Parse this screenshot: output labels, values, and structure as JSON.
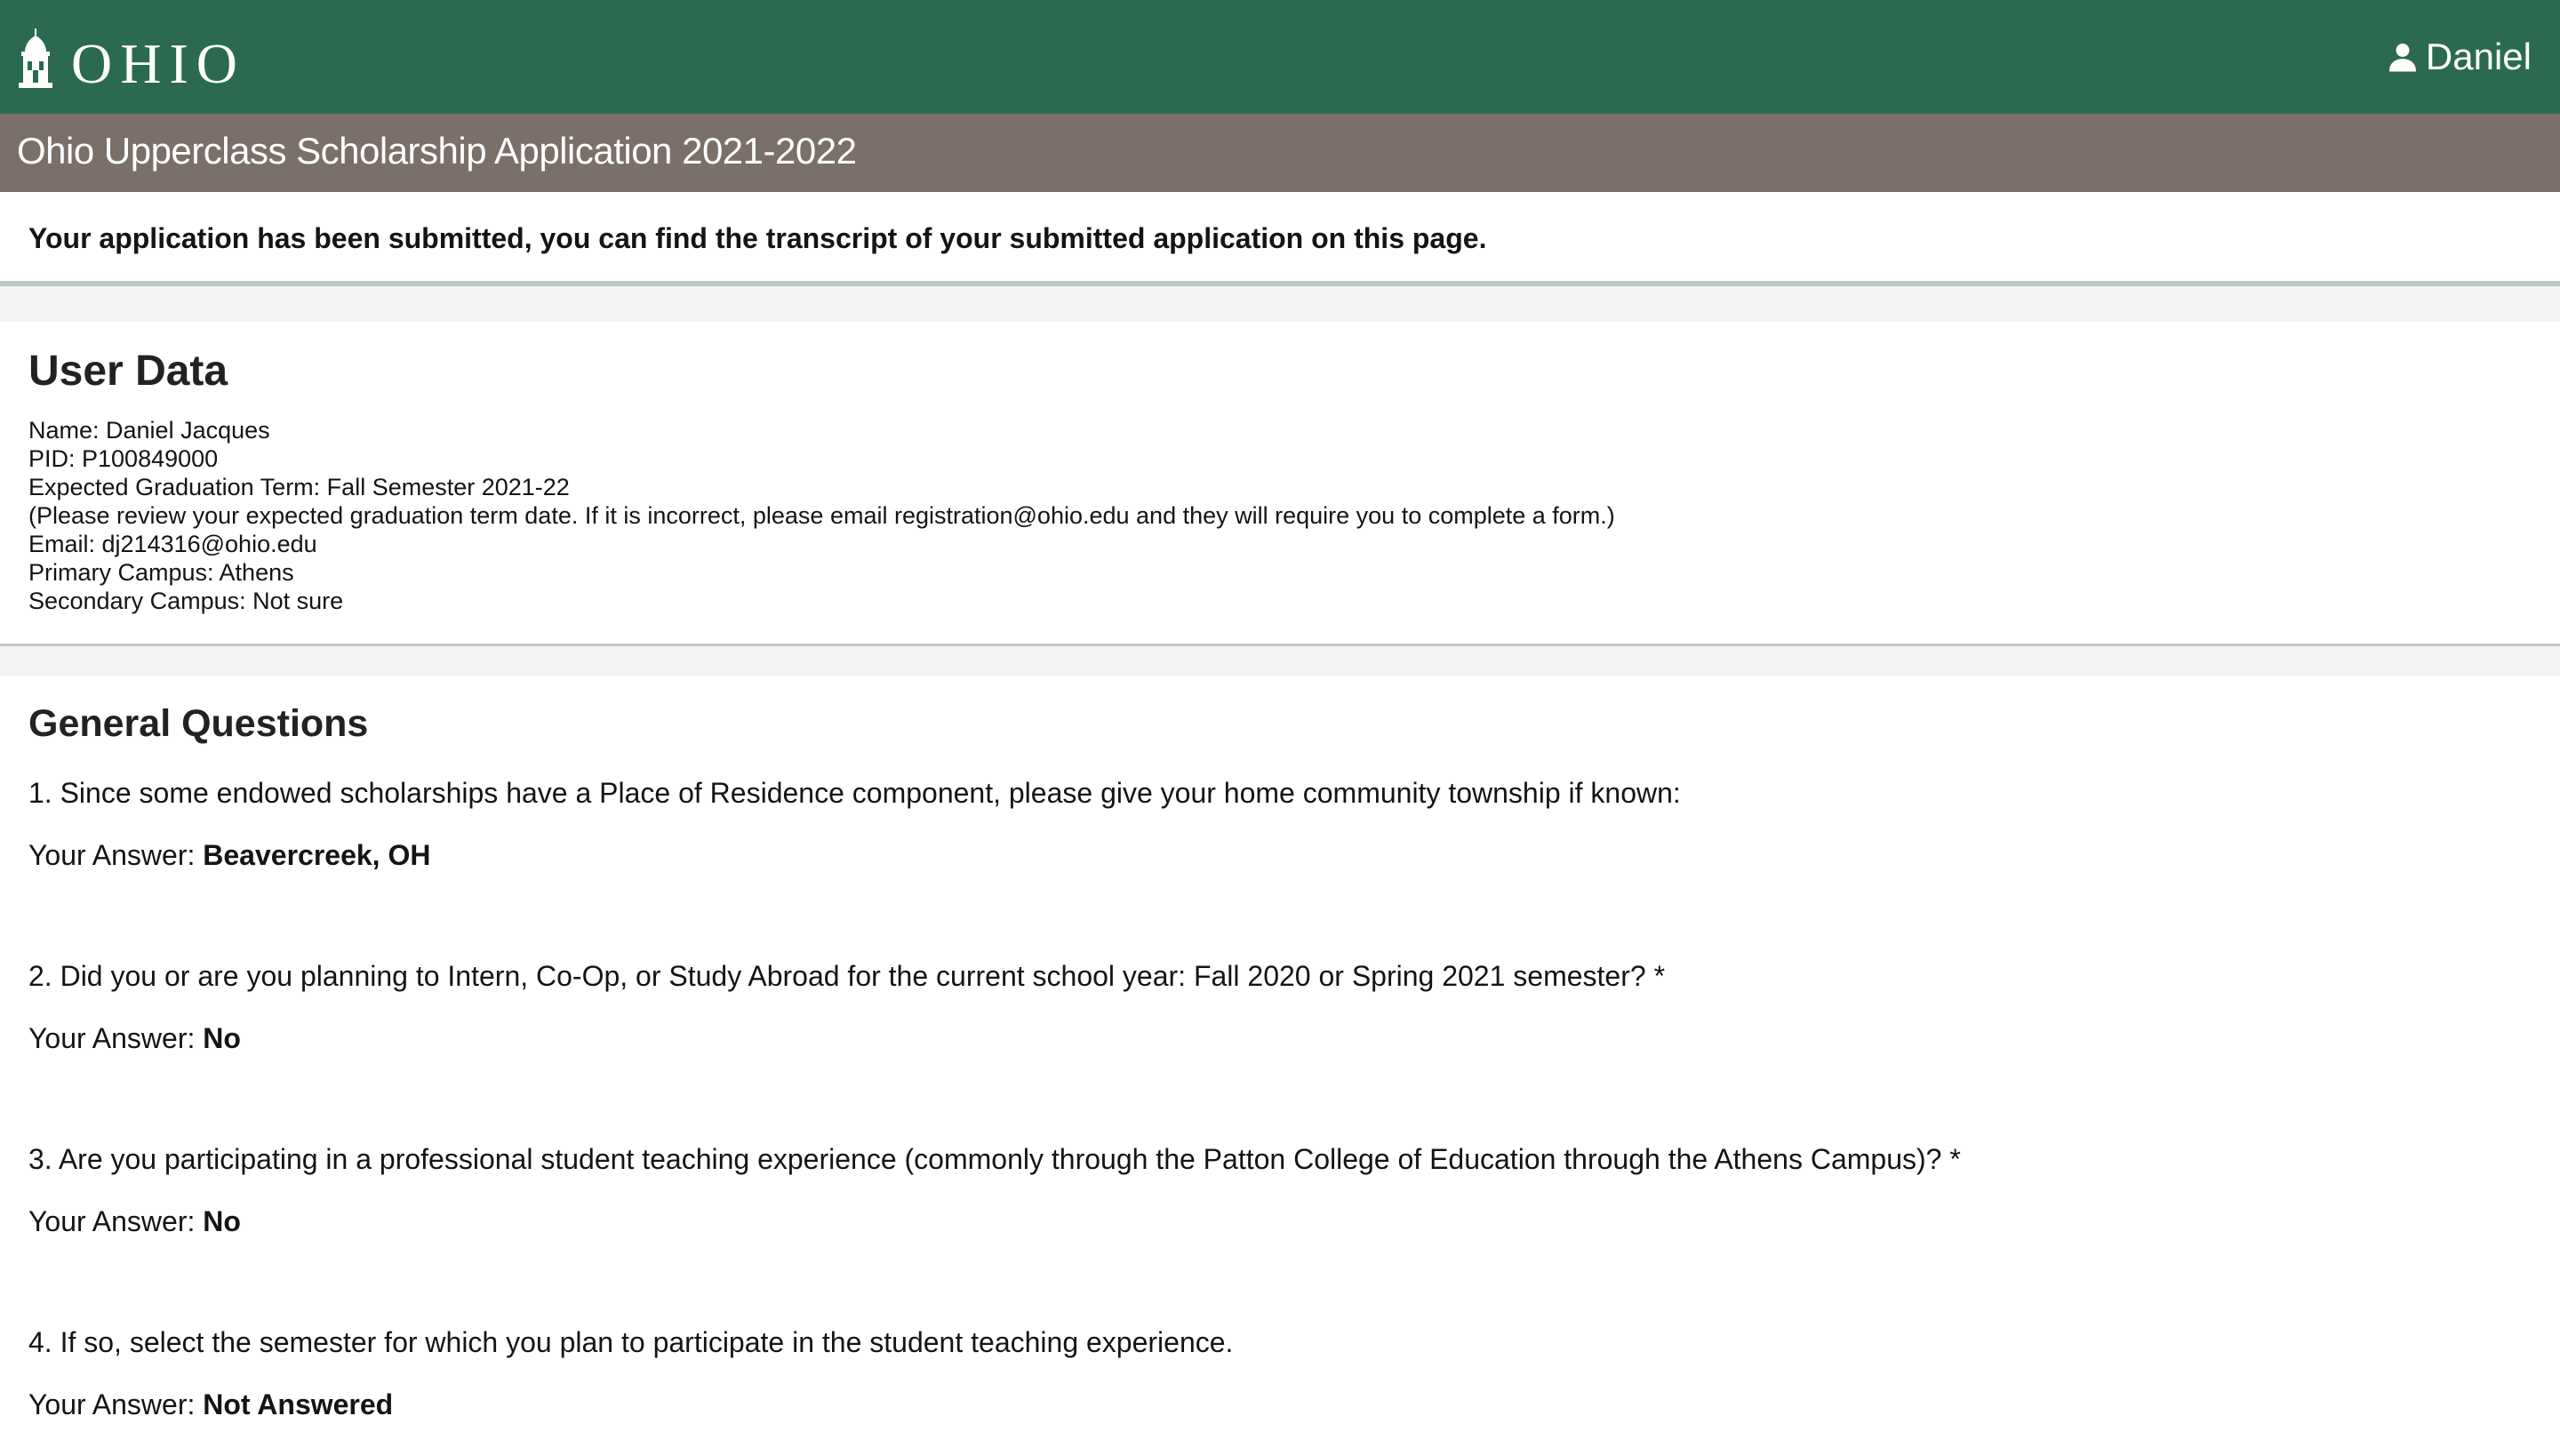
{
  "header": {
    "logo_text": "OHIO",
    "user_name": "Daniel",
    "brand_color": "#2b6a50"
  },
  "subheader": {
    "title": "Ohio Upperclass Scholarship Application 2021-2022",
    "color": "#7a6f69"
  },
  "notice": {
    "text": "Your application has been submitted, you can find the transcript of your submitted application on this page."
  },
  "user_data": {
    "heading": "User Data",
    "lines": [
      "Name: Daniel Jacques",
      "PID: P100849000",
      "Expected Graduation Term: Fall Semester 2021-22",
      "(Please review your expected graduation term date. If it is incorrect, please email registration@ohio.edu and they will require you to complete a form.)",
      "Email: dj214316@ohio.edu",
      "Primary Campus: Athens",
      "Secondary Campus: Not sure"
    ]
  },
  "general_questions": {
    "heading": "General Questions",
    "answer_label": "Your Answer:",
    "items": [
      {
        "question": "1. Since some endowed scholarships have a Place of Residence component, please give your home community township if known:",
        "answer": "Beavercreek, OH"
      },
      {
        "question": "2. Did you or are you planning to Intern, Co-Op, or Study Abroad for the current school year: Fall 2020 or Spring 2021 semester? *",
        "answer": "No"
      },
      {
        "question": "3. Are you participating in a professional student teaching experience (commonly through the Patton College of Education through the Athens Campus)? *",
        "answer": "No"
      },
      {
        "question": "4. If so, select the semester for which you plan to participate in the student teaching experience.",
        "answer": "Not Answered"
      }
    ]
  }
}
